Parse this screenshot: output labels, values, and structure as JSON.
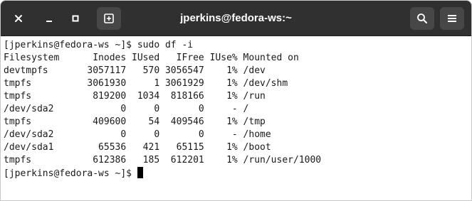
{
  "window": {
    "title": "jperkins@fedora-ws:~"
  },
  "titlebar": {
    "buttons": {
      "close": "close-icon",
      "minimize": "minimize-icon",
      "maximize": "maximize-icon",
      "new_tab": "new-tab-icon",
      "search": "search-icon",
      "menu": "hamburger-menu-icon"
    }
  },
  "terminal": {
    "command_line": "[jperkins@fedora-ws ~]$ sudo df -i",
    "header": "Filesystem      Inodes IUsed   IFree IUse% Mounted on",
    "rows": [
      "devtmpfs       3057117   570 3056547    1% /dev",
      "tmpfs          3061930     1 3061929    1% /dev/shm",
      "tmpfs           819200  1034  818166    1% /run",
      "/dev/sda2            0     0       0     - /",
      "tmpfs           409600    54  409546    1% /tmp",
      "/dev/sda2            0     0       0     - /home",
      "/dev/sda1        65536   421   65115    1% /boot",
      "tmpfs           612386   185  612201    1% /run/user/1000"
    ],
    "prompt": "[jperkins@fedora-ws ~]$ "
  },
  "colors": {
    "titlebar_bg": "#303030",
    "terminal_bg": "#ffffff",
    "terminal_fg": "#1a1a1a"
  }
}
